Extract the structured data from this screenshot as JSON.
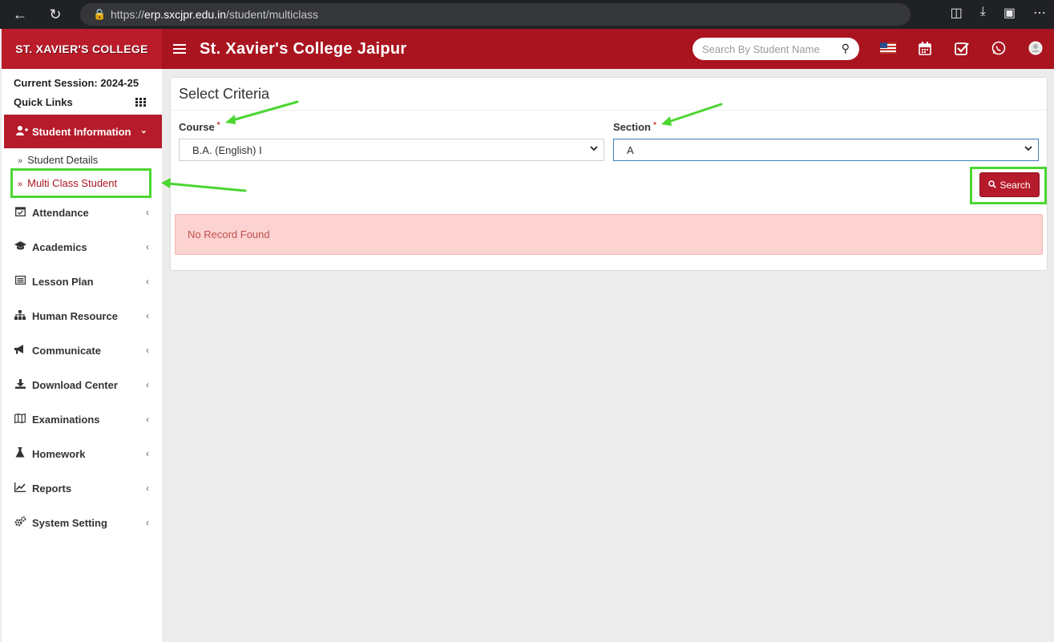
{
  "browser": {
    "url_scheme": "https://",
    "url_host": "erp.sxcjpr.edu.in",
    "url_path": "/student/multiclass"
  },
  "app": {
    "logo_text": "ST. XAVIER'S COLLEGE",
    "title": "St. Xavier's College Jaipur",
    "search_placeholder": "Search By Student Name"
  },
  "sidebar": {
    "session": "Current Session: 2024-25",
    "quick_links": "Quick Links",
    "active_menu": "Student Information",
    "sub_items": [
      "Student Details",
      "Multi Class Student"
    ],
    "menu": [
      {
        "label": "Attendance",
        "icon": "calendar-check-icon"
      },
      {
        "label": "Academics",
        "icon": "graduation-cap-icon"
      },
      {
        "label": "Lesson Plan",
        "icon": "list-icon"
      },
      {
        "label": "Human Resource",
        "icon": "sitemap-icon"
      },
      {
        "label": "Communicate",
        "icon": "bullhorn-icon"
      },
      {
        "label": "Download Center",
        "icon": "download-icon"
      },
      {
        "label": "Examinations",
        "icon": "map-icon"
      },
      {
        "label": "Homework",
        "icon": "flask-icon"
      },
      {
        "label": "Reports",
        "icon": "line-chart-icon"
      },
      {
        "label": "System Setting",
        "icon": "gears-icon"
      }
    ]
  },
  "main": {
    "card_title": "Select Criteria",
    "course_label": "Course",
    "course_value": "B.A. (English) I",
    "section_label": "Section",
    "section_value": "A",
    "required_mark": "*",
    "search_button": "Search",
    "alert": "No Record Found"
  },
  "colors": {
    "brand": "#a9141f",
    "active": "#b51b2a",
    "annotation": "#4cd632",
    "alert_bg": "#fcd3d1"
  }
}
